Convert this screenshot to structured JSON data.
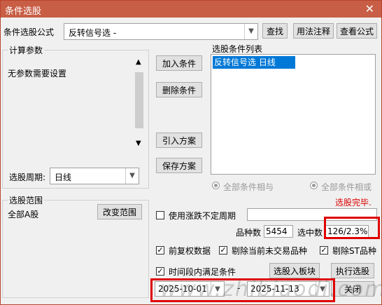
{
  "window": {
    "title": "条件选股",
    "close_glyph": "✕"
  },
  "formula": {
    "label": "条件选股公式",
    "value": "反转信号选  -",
    "find": "查找",
    "usage": "用法注释",
    "view": "查看公式"
  },
  "params": {
    "group": "计算参数",
    "text": "无参数需要设置",
    "period_label": "选股周期:",
    "period_value": "日线"
  },
  "actions": {
    "add": "加入条件",
    "delete": "删除条件",
    "import": "引入方案",
    "save": "保存方案"
  },
  "conditions": {
    "group": "选股条件列表",
    "items": [
      "反转信号选  日线"
    ]
  },
  "logic": {
    "and": "全部条件相与",
    "or": "全部条件相或"
  },
  "status": {
    "done": "选股完毕."
  },
  "range": {
    "group": "选股范围",
    "value": "全部A股",
    "change": "改变范围"
  },
  "options": {
    "variable_period": "使用涨跌不定周期",
    "count_label": "品种数",
    "count_value": "5454",
    "selected_label": "选中数",
    "selected_value": "126/2.3%",
    "fq": "前复权数据",
    "exclude_untraded": "剔除当前未交易品种",
    "exclude_st": "剔除ST品种",
    "time_range": "时间段内满足条件",
    "date_start": "2025-10-01",
    "date_sep": "-",
    "date_end": "2025-11-13",
    "to_block": "选股入板块",
    "run": "执行选股",
    "close": "关闭"
  },
  "watermark": "www.zhibiaodi.com"
}
